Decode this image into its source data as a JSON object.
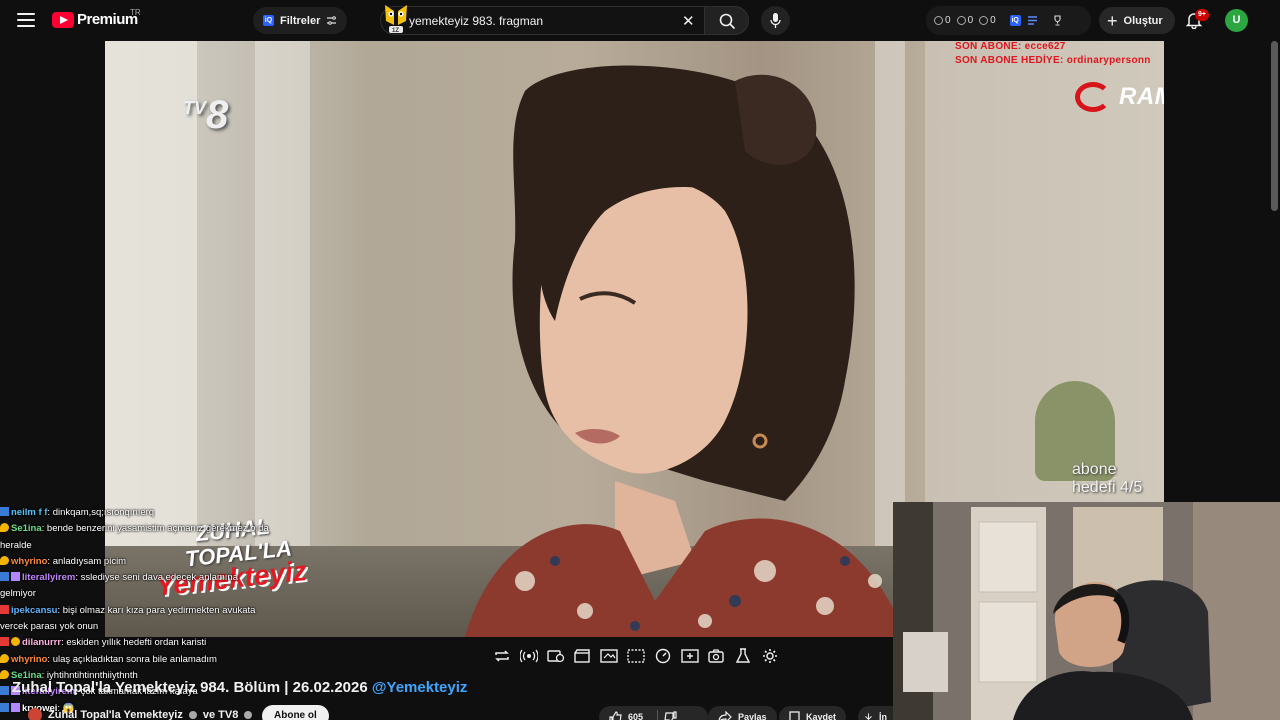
{
  "topbar": {
    "logo_text": "Premium",
    "region_code": "TR",
    "filters_label": "Filtreler",
    "search_value": "yemekteyiz 983. fragman",
    "extension_counts": [
      "0",
      "0",
      "0"
    ],
    "create_label": "Oluştur",
    "notifications_badge": "9+",
    "avatar_letter": "U"
  },
  "video": {
    "tv_logo": "TV8",
    "last_sub_line": "SON ABONE: ecce627",
    "last_gift_line": "SON ABONE HEDİYE: ordinarypersonn",
    "sponsor": "RAMPAGE",
    "sub_goal": "abone hedefi 4/5",
    "show_logo_line1": "ZUHAL",
    "show_logo_line2": "TOPAL'LA",
    "show_logo_line3": "Yemekteyiz"
  },
  "chat": [
    {
      "user": "neilm f f",
      "msg": ": dinkqam,sq;ısıonqınıerq",
      "color": "#4fc3f7",
      "badge": "blue"
    },
    {
      "user": "Se1ina",
      "msg": ": bende benzerini yasamistim açmanız gerekmez o da",
      "color": "#66e08a",
      "badge": "gold"
    },
    {
      "user": "",
      "msg": "heralde",
      "color": "#ffffff",
      "badge": ""
    },
    {
      "user": "whyrino",
      "msg": ": anladıysam picim",
      "color": "#ff8a3d",
      "badge": "gold"
    },
    {
      "user": "literallyirem",
      "msg": ": sslediyse seni dava edecek anlamına",
      "color": "#c084fc",
      "badge": "blue2"
    },
    {
      "user": "",
      "msg": "gelmiyor",
      "color": "#ffffff",
      "badge": ""
    },
    {
      "user": "ipekcansu",
      "msg": ": bişi olmaz karı kıza para yedirmekten avukata",
      "color": "#5fb3ff",
      "badge": "red"
    },
    {
      "user": "",
      "msg": "vercek parası yok onun",
      "color": "#ffffff",
      "badge": ""
    },
    {
      "user": "dilanurrr",
      "msg": ": eskiden yıllık hedefti ordan karisti",
      "color": "#ffb4e0",
      "badge": "red2"
    },
    {
      "user": "whyrino",
      "msg": ": ulaş açıkladıktan sonra bile anlamadım",
      "color": "#ff8a3d",
      "badge": "gold"
    },
    {
      "user": "Se1ina",
      "msg": ": iyhtihntihtinnthiiythnth",
      "color": "#66e08a",
      "badge": "gold"
    },
    {
      "user": "literallyirem",
      "msg": ": çok takmamak lazım kafaya",
      "color": "#c084fc",
      "badge": "blue2"
    },
    {
      "user": "kryowei",
      "msg": ": 😱",
      "color": "#ffffff",
      "badge": "blue2"
    }
  ],
  "below": {
    "title": "Zuhal Topal'la Yemekteyiz 984. Bölüm | 26.02.2026",
    "title_handle": "@Yemekteyiz",
    "channel_line": "Zuhal Topal'la Yemekteyiz",
    "channel_and": "ve TV8",
    "subscribe_label": "Abone ol",
    "like_count": "605",
    "share_label": "Paylaş",
    "save_label": "Kaydet",
    "download_label": "İn"
  },
  "colors": {
    "accent_red": "#ff0033",
    "link_blue": "#3ea6ff",
    "overlay_red": "#e0151d"
  }
}
